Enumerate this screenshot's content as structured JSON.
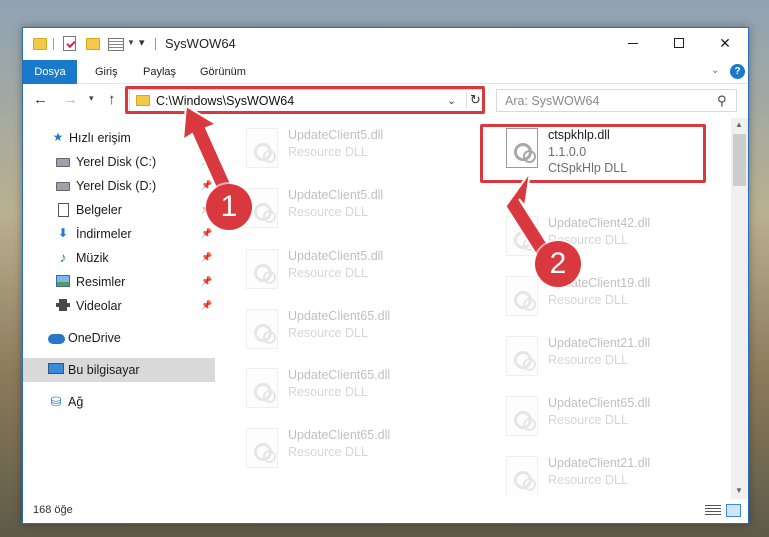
{
  "window": {
    "title": "SysWOW64"
  },
  "ribbon": {
    "tabs": [
      {
        "label": "Dosya",
        "active": true
      },
      {
        "label": "Giriş"
      },
      {
        "label": "Paylaş"
      },
      {
        "label": "Görünüm"
      }
    ],
    "help_label": "?"
  },
  "address": {
    "path": "C:\\Windows\\SysWOW64"
  },
  "search": {
    "placeholder": "Ara: SysWOW64"
  },
  "sidebar": {
    "items": [
      {
        "label": "Hızlı erişim",
        "icon": "star-icon"
      },
      {
        "label": "Yerel Disk (C:)",
        "icon": "drive-icon",
        "pinned": true
      },
      {
        "label": "Yerel Disk (D:)",
        "icon": "drive-icon",
        "pinned": true
      },
      {
        "label": "Belgeler",
        "icon": "document-icon",
        "pinned": true
      },
      {
        "label": "İndirmeler",
        "icon": "download-icon",
        "pinned": true
      },
      {
        "label": "Müzik",
        "icon": "music-icon",
        "pinned": true
      },
      {
        "label": "Resimler",
        "icon": "pictures-icon",
        "pinned": true
      },
      {
        "label": "Videolar",
        "icon": "videos-icon",
        "pinned": true
      },
      {
        "label": "OneDrive",
        "icon": "cloud-icon"
      },
      {
        "label": "Bu bilgisayar",
        "icon": "computer-icon",
        "selected": true
      },
      {
        "label": "Ağ",
        "icon": "network-icon"
      }
    ]
  },
  "files": {
    "left_column": [
      {
        "name": "UpdateClient5.dll",
        "type": "Resource DLL"
      },
      {
        "name": "UpdateClient5.dll",
        "type": "Resource DLL"
      },
      {
        "name": "UpdateClient5.dll",
        "type": "Resource DLL"
      },
      {
        "name": "UpdateClient65.dll",
        "type": "Resource DLL"
      },
      {
        "name": "UpdateClient65.dll",
        "type": "Resource DLL"
      },
      {
        "name": "UpdateClient65.dll",
        "type": "Resource DLL"
      }
    ],
    "right_column": [
      {
        "name": "UpdateClient42.dll",
        "type": "Resource DLL"
      },
      {
        "name": "UpdateClient19.dll",
        "type": "Resource DLL"
      },
      {
        "name": "UpdateClient21.dll",
        "type": "Resource DLL"
      },
      {
        "name": "UpdateClient65.dll",
        "type": "Resource DLL"
      },
      {
        "name": "UpdateClient21.dll",
        "type": "Resource DLL"
      }
    ],
    "highlighted": {
      "name": "ctspkhlp.dll",
      "version": "1.1.0.0",
      "type": "CtSpkHlp DLL"
    }
  },
  "status": {
    "item_count": "168 öğe"
  },
  "annotations": {
    "step1": "1",
    "step2": "2",
    "color": "#d9383f"
  }
}
